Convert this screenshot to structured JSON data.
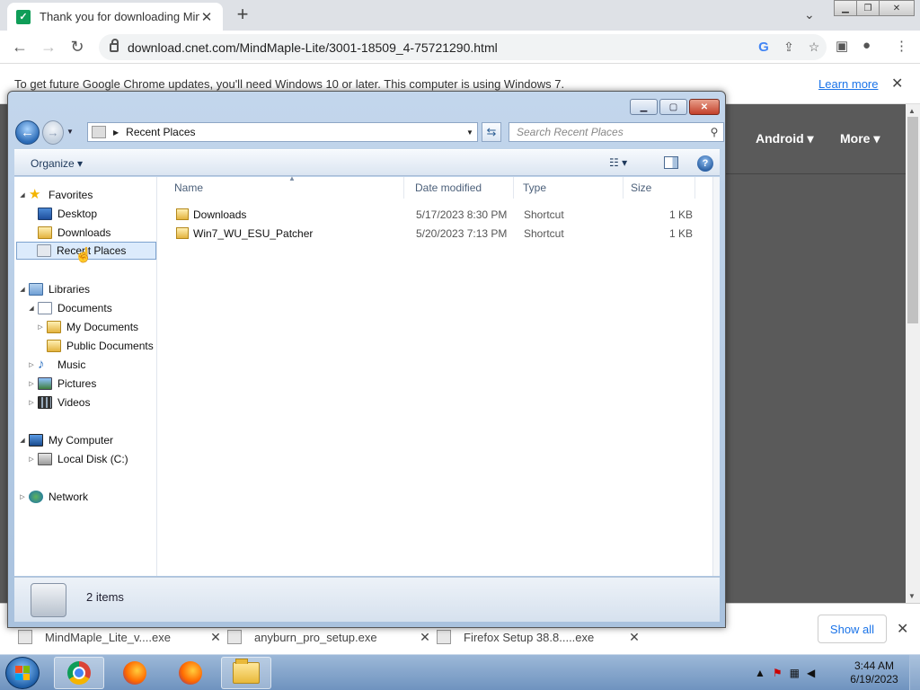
{
  "browser": {
    "tab_title": "Thank you for downloading MindMaple",
    "tab_close": "✕",
    "new_tab": "+",
    "url": "download.cnet.com/MindMaple-Lite/3001-18509_4-75721290.html",
    "infobar_text": "To get future Google Chrome updates, you'll need Windows 10 or later. This computer is using Windows 7.",
    "learn_more": "Learn more",
    "site_nav": [
      "Android",
      "More"
    ]
  },
  "downloads": {
    "items": [
      "MindMaple_Lite_v....exe",
      "anyburn_pro_setup.exe",
      "Firefox Setup 38.8.....exe"
    ],
    "show_all": "Show all"
  },
  "explorer": {
    "address": "Recent Places",
    "search_placeholder": "Search Recent Places",
    "organize": "Organize",
    "tree": {
      "favorites": "Favorites",
      "desktop": "Desktop",
      "downloads": "Downloads",
      "recent_places": "Recent Places",
      "libraries": "Libraries",
      "documents": "Documents",
      "my_documents": "My Documents",
      "public_documents": "Public Documents",
      "music": "Music",
      "pictures": "Pictures",
      "videos": "Videos",
      "my_computer": "My Computer",
      "local_disk": "Local Disk (C:)",
      "network": "Network"
    },
    "columns": {
      "name": "Name",
      "date_modified": "Date modified",
      "type": "Type",
      "size": "Size"
    },
    "files": [
      {
        "name": "Downloads",
        "date": "5/17/2023 8:30 PM",
        "type": "Shortcut",
        "size": "1 KB"
      },
      {
        "name": "Win7_WU_ESU_Patcher",
        "date": "5/20/2023 7:13 PM",
        "type": "Shortcut",
        "size": "1 KB"
      }
    ],
    "status": "2 items"
  },
  "taskbar": {
    "time": "3:44 AM",
    "date": "6/19/2023"
  },
  "colors": {
    "chrome_tabbar": "#dee1e6",
    "link_blue": "#1a73e8",
    "taskbar_blue": "#6f93bf",
    "selection": "#dcebfc"
  }
}
